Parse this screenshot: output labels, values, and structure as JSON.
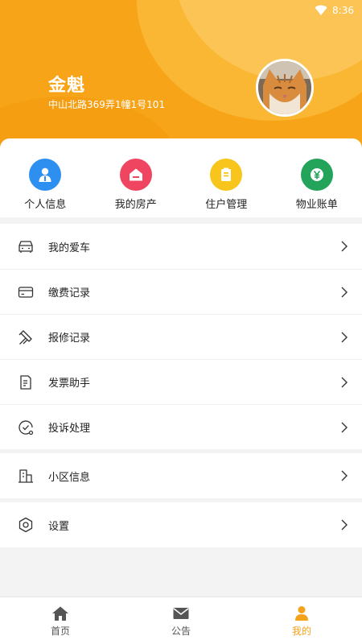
{
  "status_bar": {
    "time": "8:36",
    "wifi_icon": "wifi-icon"
  },
  "profile": {
    "name": "金魁",
    "address": "中山北路369弄1幢1号101",
    "avatar_icon": "cat-avatar"
  },
  "quick_actions": [
    {
      "label": "个人信息",
      "icon": "person-icon",
      "color": "#2d8ff0"
    },
    {
      "label": "我的房产",
      "icon": "house-icon",
      "color": "#ef4560"
    },
    {
      "label": "住户管理",
      "icon": "clipboard-icon",
      "color": "#f7c51b"
    },
    {
      "label": "物业账单",
      "icon": "yen-icon",
      "color": "#23a45a"
    }
  ],
  "menu": [
    {
      "label": "我的爱车",
      "icon": "car-icon"
    },
    {
      "label": "缴费记录",
      "icon": "card-icon"
    },
    {
      "label": "报修记录",
      "icon": "repair-icon"
    },
    {
      "label": "发票助手",
      "icon": "invoice-icon"
    },
    {
      "label": "投诉处理",
      "icon": "complaint-icon"
    },
    {
      "label": "小区信息",
      "icon": "building-icon"
    },
    {
      "label": "设置",
      "icon": "settings-icon"
    }
  ],
  "bottom_nav": [
    {
      "label": "首页",
      "icon": "home-icon"
    },
    {
      "label": "公告",
      "icon": "mail-icon"
    },
    {
      "label": "我的",
      "icon": "user-icon",
      "active": true
    }
  ],
  "colors": {
    "accent": "#f7a418",
    "nav_active": "#f5a21b"
  }
}
